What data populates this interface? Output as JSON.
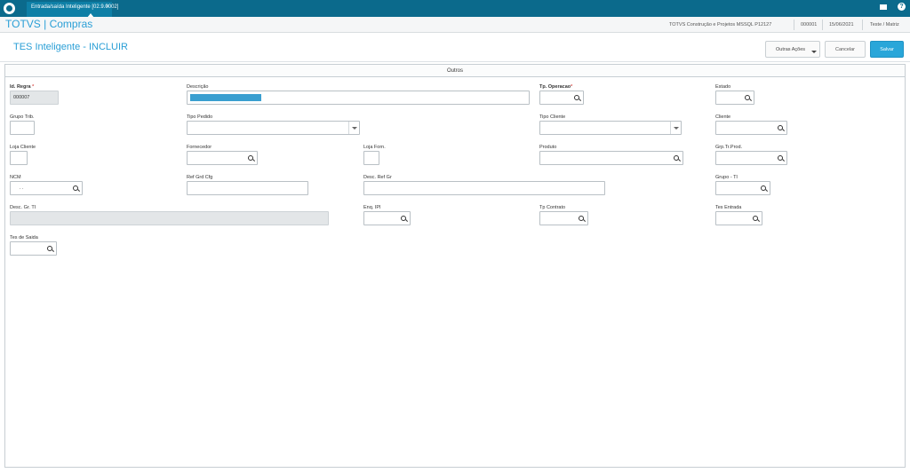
{
  "top": {
    "tab_label": "Entrada/saída Inteligente [02.9.0002]",
    "tab_close": "×"
  },
  "info": {
    "brand": "TOTVS | Compras",
    "company": "TOTVS Construção e Projetos MSSQL P12127",
    "code": "000001",
    "date": "15/06/2021",
    "branch": "Teste / Matriz"
  },
  "header": {
    "title": "TES Inteligente - INCLUIR",
    "other_actions": "Outras Ações",
    "cancel": "Cancelar",
    "save": "Salvar"
  },
  "section": {
    "title": "Outros"
  },
  "fields": {
    "id_regra": {
      "label": "Id. Regra",
      "value": "000007",
      "required": "*"
    },
    "descricao": {
      "label": "Descrição"
    },
    "tp_operacao": {
      "label": "Tp. Operacao",
      "required": "*"
    },
    "estado": {
      "label": "Estado"
    },
    "grupo_trib": {
      "label": "Grupo Trib."
    },
    "tipo_pedido": {
      "label": "Tipo Pedido"
    },
    "tipo_cliente": {
      "label": "Tipo Cliente"
    },
    "cliente": {
      "label": "Cliente"
    },
    "loja_cliente": {
      "label": "Loja Cliente"
    },
    "fornecedor": {
      "label": "Fornecedor"
    },
    "loja_forn": {
      "label": "Loja Forn."
    },
    "produto": {
      "label": "Produto"
    },
    "grp_tr_prod": {
      "label": "Grp.Tr.Prod."
    },
    "ncm": {
      "label": "NCM",
      "value": ". ."
    },
    "ref_grd_cfg": {
      "label": "Ref Grd Cfg"
    },
    "desc_ref_gr": {
      "label": "Desc. Ref Gr"
    },
    "grupo_ti": {
      "label": "Grupo - TI"
    },
    "desc_gr_ti": {
      "label": "Desc. Gr. TI"
    },
    "enq_ipi": {
      "label": "Enq. IPI"
    },
    "tp_contrato": {
      "label": "Tp Contrato"
    },
    "tes_entrada": {
      "label": "Tes Entrada"
    },
    "tes_saida": {
      "label": "Tes de Saida"
    }
  },
  "icons": {
    "search": "search-icon",
    "dropdown": "chevron-down-icon",
    "mail": "mail-icon",
    "help": "help-icon",
    "logo": "totvs-logo"
  },
  "colors": {
    "topbar": "#0b6a8c",
    "accent": "#2a9fd6",
    "save": "#29a6d9"
  }
}
